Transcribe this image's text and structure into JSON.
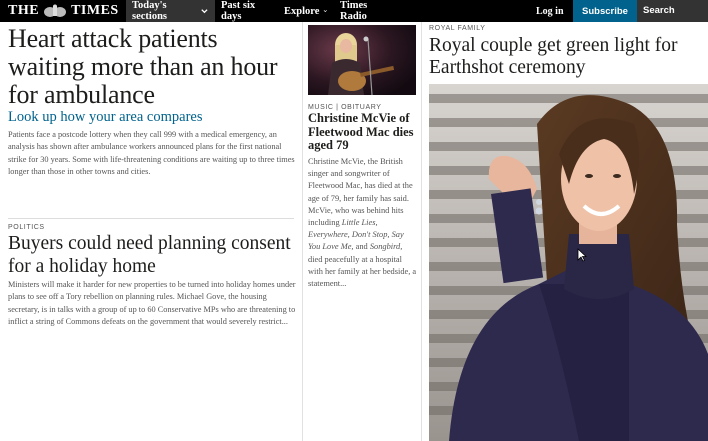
{
  "header": {
    "logo_left": "THE",
    "logo_right": "TIMES",
    "nav": [
      {
        "label": "Today's sections"
      },
      {
        "label": "Past six days"
      },
      {
        "label": "Explore"
      },
      {
        "label": "Times Radio"
      }
    ],
    "login": "Log in",
    "subscribe": "Subscribe",
    "search": "Search"
  },
  "lead": {
    "headline": "Heart attack patients waiting more than an hour for ambulance",
    "subheadline": "Look up how your area compares",
    "body": "Patients face a postcode lottery when they call 999 with a medical emergency, an analysis has shown after ambulance workers announced plans for the first national strike for 30 years. Some with life-threatening conditions are waiting up to three times longer than those in other towns and cities."
  },
  "politics": {
    "kicker": "POLITICS",
    "headline": "Buyers could need planning consent for a holiday home",
    "body": "Ministers will make it harder for new properties to be turned into holiday homes under plans to see off a Tory rebellion on planning rules. Michael Gove, the housing secretary, is in talks with a group of up to 60 Conservative MPs who are threatening to inflict a string of Commons defeats on the government that would severely restrict..."
  },
  "music": {
    "kicker": "MUSIC | OBITUARY",
    "headline": "Christine McVie of Fleetwood Mac dies aged 79",
    "body_1": "Christine McVie, the British singer and songwriter of Fleetwood Mac, has died at the age of 79, her family has said. McVie, who was behind hits including ",
    "song_1": "Little Lies, Everywhere, Don't Stop, Say You Love Me,",
    "body_2": " and ",
    "song_2": "Songbird,",
    "body_3": " died peacefully at a hospital with her family at her bedside, a statement..."
  },
  "royal": {
    "kicker": "ROYAL FAMILY",
    "headline": "Royal couple get green light for Earthshot ceremony"
  },
  "colors": {
    "nav_bg": "#000000",
    "nav_active": "#333333",
    "subscribe_bg": "#00628d",
    "link_blue": "#00628d",
    "body_grey": "#555555"
  }
}
